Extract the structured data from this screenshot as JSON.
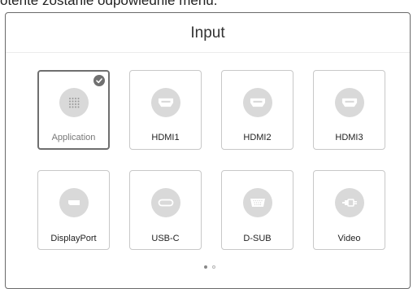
{
  "top_caption": "otente zostanie odpowiednie menu.",
  "title": "Input",
  "selected_source": "Application",
  "sources": [
    {
      "label": "Application",
      "icon": "apps-grid-icon",
      "selected": true
    },
    {
      "label": "HDMI1",
      "icon": "hdmi-icon",
      "selected": false
    },
    {
      "label": "HDMI2",
      "icon": "hdmi-icon",
      "selected": false
    },
    {
      "label": "HDMI3",
      "icon": "hdmi-icon",
      "selected": false
    },
    {
      "label": "DisplayPort",
      "icon": "displayport-icon",
      "selected": false
    },
    {
      "label": "USB-C",
      "icon": "usb-c-icon",
      "selected": false
    },
    {
      "label": "D-SUB",
      "icon": "vga-icon",
      "selected": false
    },
    {
      "label": "Video",
      "icon": "composite-video-icon",
      "selected": false
    }
  ],
  "pagination": {
    "pages": 2,
    "current": 1
  },
  "colors": {
    "icon_circle": "#d9d9d9",
    "selected_border": "#6f6f6f",
    "check_badge": "#707070"
  }
}
